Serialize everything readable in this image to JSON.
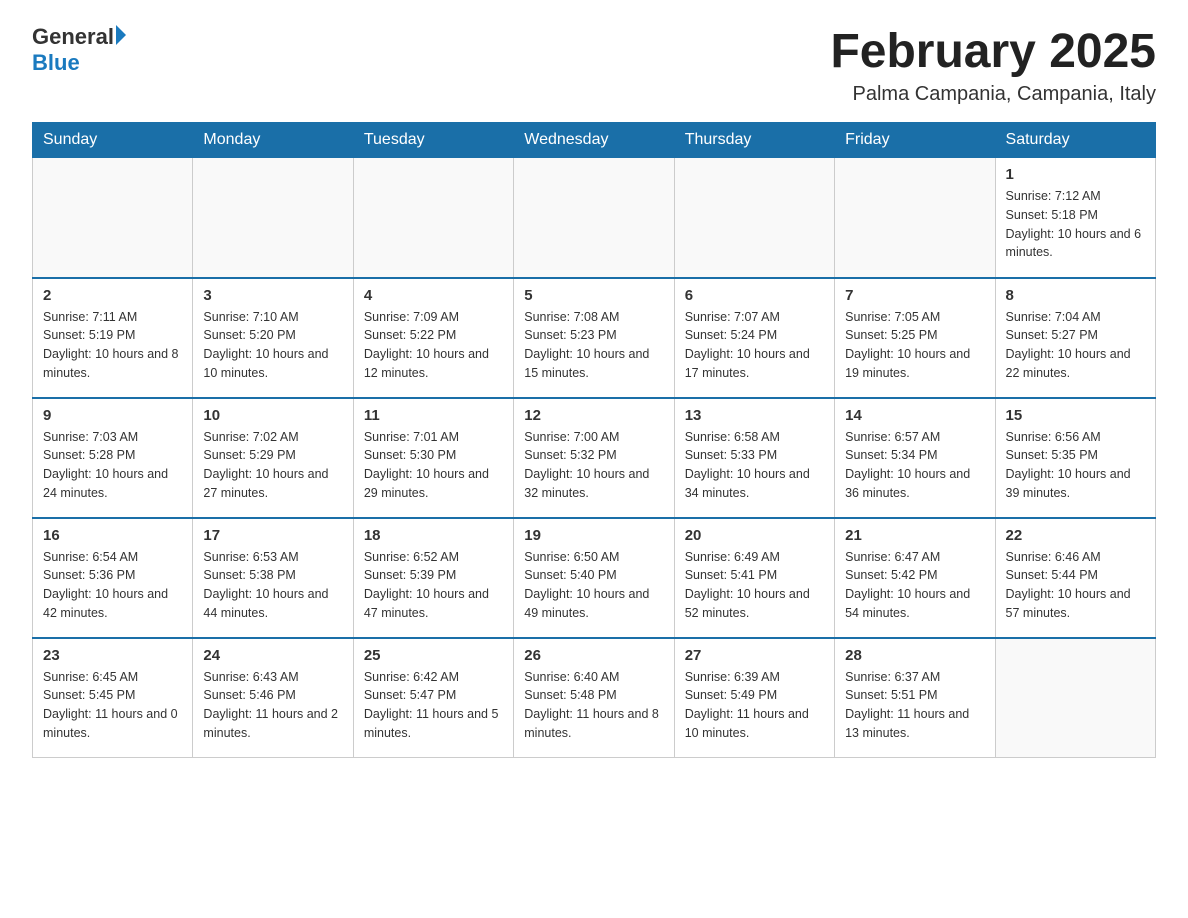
{
  "header": {
    "logo_general": "General",
    "logo_blue": "Blue",
    "month_title": "February 2025",
    "location": "Palma Campania, Campania, Italy"
  },
  "weekdays": [
    "Sunday",
    "Monday",
    "Tuesday",
    "Wednesday",
    "Thursday",
    "Friday",
    "Saturday"
  ],
  "weeks": [
    [
      {
        "day": "",
        "info": ""
      },
      {
        "day": "",
        "info": ""
      },
      {
        "day": "",
        "info": ""
      },
      {
        "day": "",
        "info": ""
      },
      {
        "day": "",
        "info": ""
      },
      {
        "day": "",
        "info": ""
      },
      {
        "day": "1",
        "info": "Sunrise: 7:12 AM\nSunset: 5:18 PM\nDaylight: 10 hours and 6 minutes."
      }
    ],
    [
      {
        "day": "2",
        "info": "Sunrise: 7:11 AM\nSunset: 5:19 PM\nDaylight: 10 hours and 8 minutes."
      },
      {
        "day": "3",
        "info": "Sunrise: 7:10 AM\nSunset: 5:20 PM\nDaylight: 10 hours and 10 minutes."
      },
      {
        "day": "4",
        "info": "Sunrise: 7:09 AM\nSunset: 5:22 PM\nDaylight: 10 hours and 12 minutes."
      },
      {
        "day": "5",
        "info": "Sunrise: 7:08 AM\nSunset: 5:23 PM\nDaylight: 10 hours and 15 minutes."
      },
      {
        "day": "6",
        "info": "Sunrise: 7:07 AM\nSunset: 5:24 PM\nDaylight: 10 hours and 17 minutes."
      },
      {
        "day": "7",
        "info": "Sunrise: 7:05 AM\nSunset: 5:25 PM\nDaylight: 10 hours and 19 minutes."
      },
      {
        "day": "8",
        "info": "Sunrise: 7:04 AM\nSunset: 5:27 PM\nDaylight: 10 hours and 22 minutes."
      }
    ],
    [
      {
        "day": "9",
        "info": "Sunrise: 7:03 AM\nSunset: 5:28 PM\nDaylight: 10 hours and 24 minutes."
      },
      {
        "day": "10",
        "info": "Sunrise: 7:02 AM\nSunset: 5:29 PM\nDaylight: 10 hours and 27 minutes."
      },
      {
        "day": "11",
        "info": "Sunrise: 7:01 AM\nSunset: 5:30 PM\nDaylight: 10 hours and 29 minutes."
      },
      {
        "day": "12",
        "info": "Sunrise: 7:00 AM\nSunset: 5:32 PM\nDaylight: 10 hours and 32 minutes."
      },
      {
        "day": "13",
        "info": "Sunrise: 6:58 AM\nSunset: 5:33 PM\nDaylight: 10 hours and 34 minutes."
      },
      {
        "day": "14",
        "info": "Sunrise: 6:57 AM\nSunset: 5:34 PM\nDaylight: 10 hours and 36 minutes."
      },
      {
        "day": "15",
        "info": "Sunrise: 6:56 AM\nSunset: 5:35 PM\nDaylight: 10 hours and 39 minutes."
      }
    ],
    [
      {
        "day": "16",
        "info": "Sunrise: 6:54 AM\nSunset: 5:36 PM\nDaylight: 10 hours and 42 minutes."
      },
      {
        "day": "17",
        "info": "Sunrise: 6:53 AM\nSunset: 5:38 PM\nDaylight: 10 hours and 44 minutes."
      },
      {
        "day": "18",
        "info": "Sunrise: 6:52 AM\nSunset: 5:39 PM\nDaylight: 10 hours and 47 minutes."
      },
      {
        "day": "19",
        "info": "Sunrise: 6:50 AM\nSunset: 5:40 PM\nDaylight: 10 hours and 49 minutes."
      },
      {
        "day": "20",
        "info": "Sunrise: 6:49 AM\nSunset: 5:41 PM\nDaylight: 10 hours and 52 minutes."
      },
      {
        "day": "21",
        "info": "Sunrise: 6:47 AM\nSunset: 5:42 PM\nDaylight: 10 hours and 54 minutes."
      },
      {
        "day": "22",
        "info": "Sunrise: 6:46 AM\nSunset: 5:44 PM\nDaylight: 10 hours and 57 minutes."
      }
    ],
    [
      {
        "day": "23",
        "info": "Sunrise: 6:45 AM\nSunset: 5:45 PM\nDaylight: 11 hours and 0 minutes."
      },
      {
        "day": "24",
        "info": "Sunrise: 6:43 AM\nSunset: 5:46 PM\nDaylight: 11 hours and 2 minutes."
      },
      {
        "day": "25",
        "info": "Sunrise: 6:42 AM\nSunset: 5:47 PM\nDaylight: 11 hours and 5 minutes."
      },
      {
        "day": "26",
        "info": "Sunrise: 6:40 AM\nSunset: 5:48 PM\nDaylight: 11 hours and 8 minutes."
      },
      {
        "day": "27",
        "info": "Sunrise: 6:39 AM\nSunset: 5:49 PM\nDaylight: 11 hours and 10 minutes."
      },
      {
        "day": "28",
        "info": "Sunrise: 6:37 AM\nSunset: 5:51 PM\nDaylight: 11 hours and 13 minutes."
      },
      {
        "day": "",
        "info": ""
      }
    ]
  ]
}
